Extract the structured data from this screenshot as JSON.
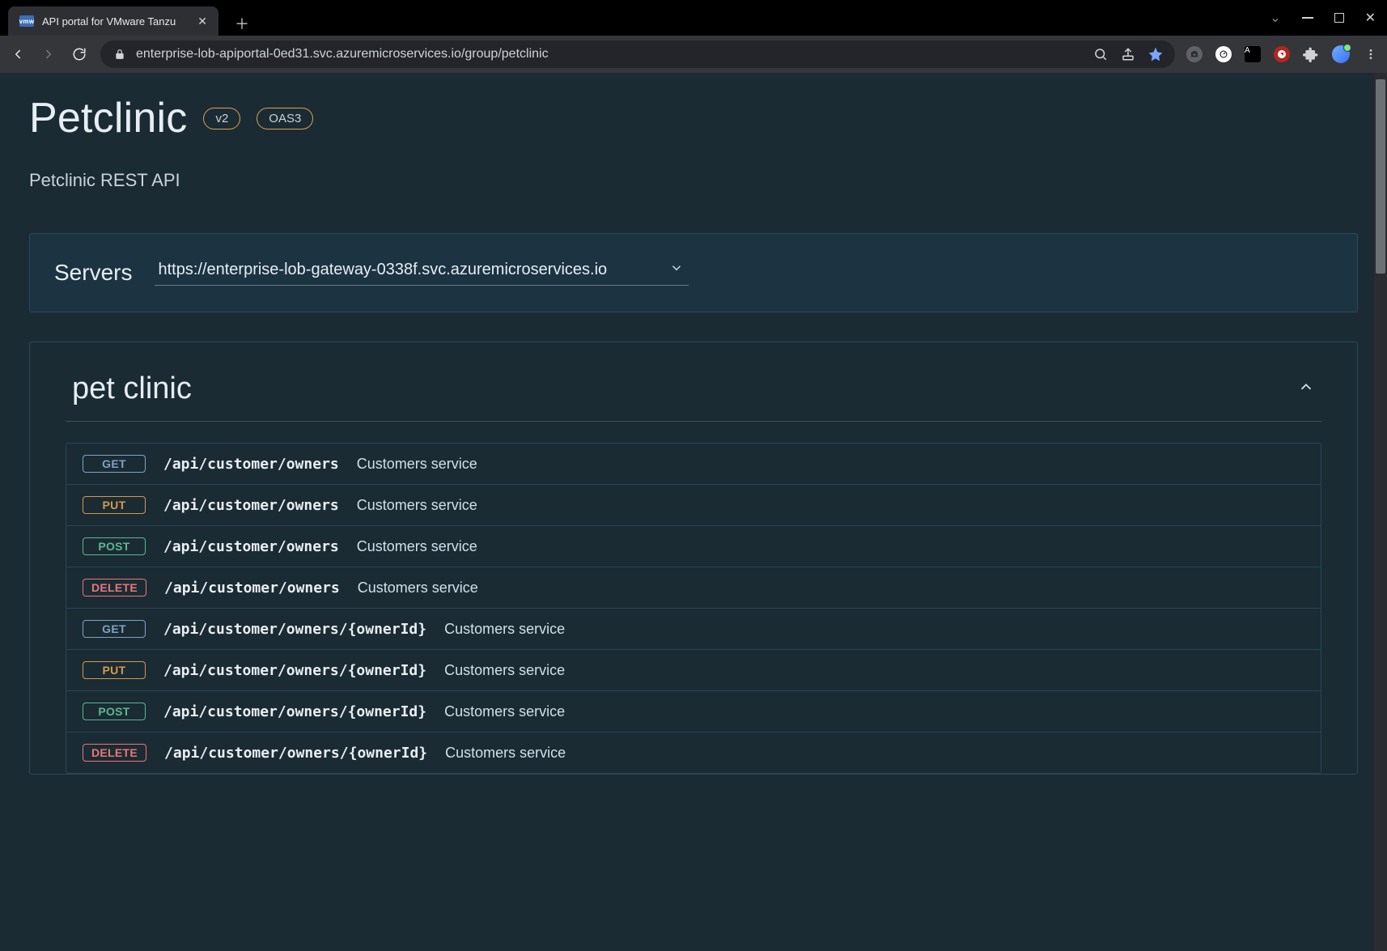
{
  "browser": {
    "tab_title": "API portal for VMware Tanzu",
    "favicon_text": "vmw",
    "url": "enterprise-lob-apiportal-0ed31.svc.azuremicroservices.io/group/petclinic"
  },
  "header": {
    "title": "Petclinic",
    "badges": [
      "v2",
      "OAS3"
    ],
    "subtitle": "Petclinic REST API"
  },
  "servers": {
    "label": "Servers",
    "selected": "https://enterprise-lob-gateway-0338f.svc.azuremicroservices.io"
  },
  "section": {
    "title": "pet clinic",
    "expanded": true
  },
  "verb_colors": {
    "GET": "#7fa3c2",
    "PUT": "#d39a4a",
    "POST": "#5bb88e",
    "DELETE": "#e77878"
  },
  "endpoints": [
    {
      "verb": "GET",
      "path": "/api/customer/owners",
      "desc": "Customers service"
    },
    {
      "verb": "PUT",
      "path": "/api/customer/owners",
      "desc": "Customers service"
    },
    {
      "verb": "POST",
      "path": "/api/customer/owners",
      "desc": "Customers service"
    },
    {
      "verb": "DELETE",
      "path": "/api/customer/owners",
      "desc": "Customers service"
    },
    {
      "verb": "GET",
      "path": "/api/customer/owners/{ownerId}",
      "desc": "Customers service"
    },
    {
      "verb": "PUT",
      "path": "/api/customer/owners/{ownerId}",
      "desc": "Customers service"
    },
    {
      "verb": "POST",
      "path": "/api/customer/owners/{ownerId}",
      "desc": "Customers service"
    },
    {
      "verb": "DELETE",
      "path": "/api/customer/owners/{ownerId}",
      "desc": "Customers service"
    }
  ]
}
